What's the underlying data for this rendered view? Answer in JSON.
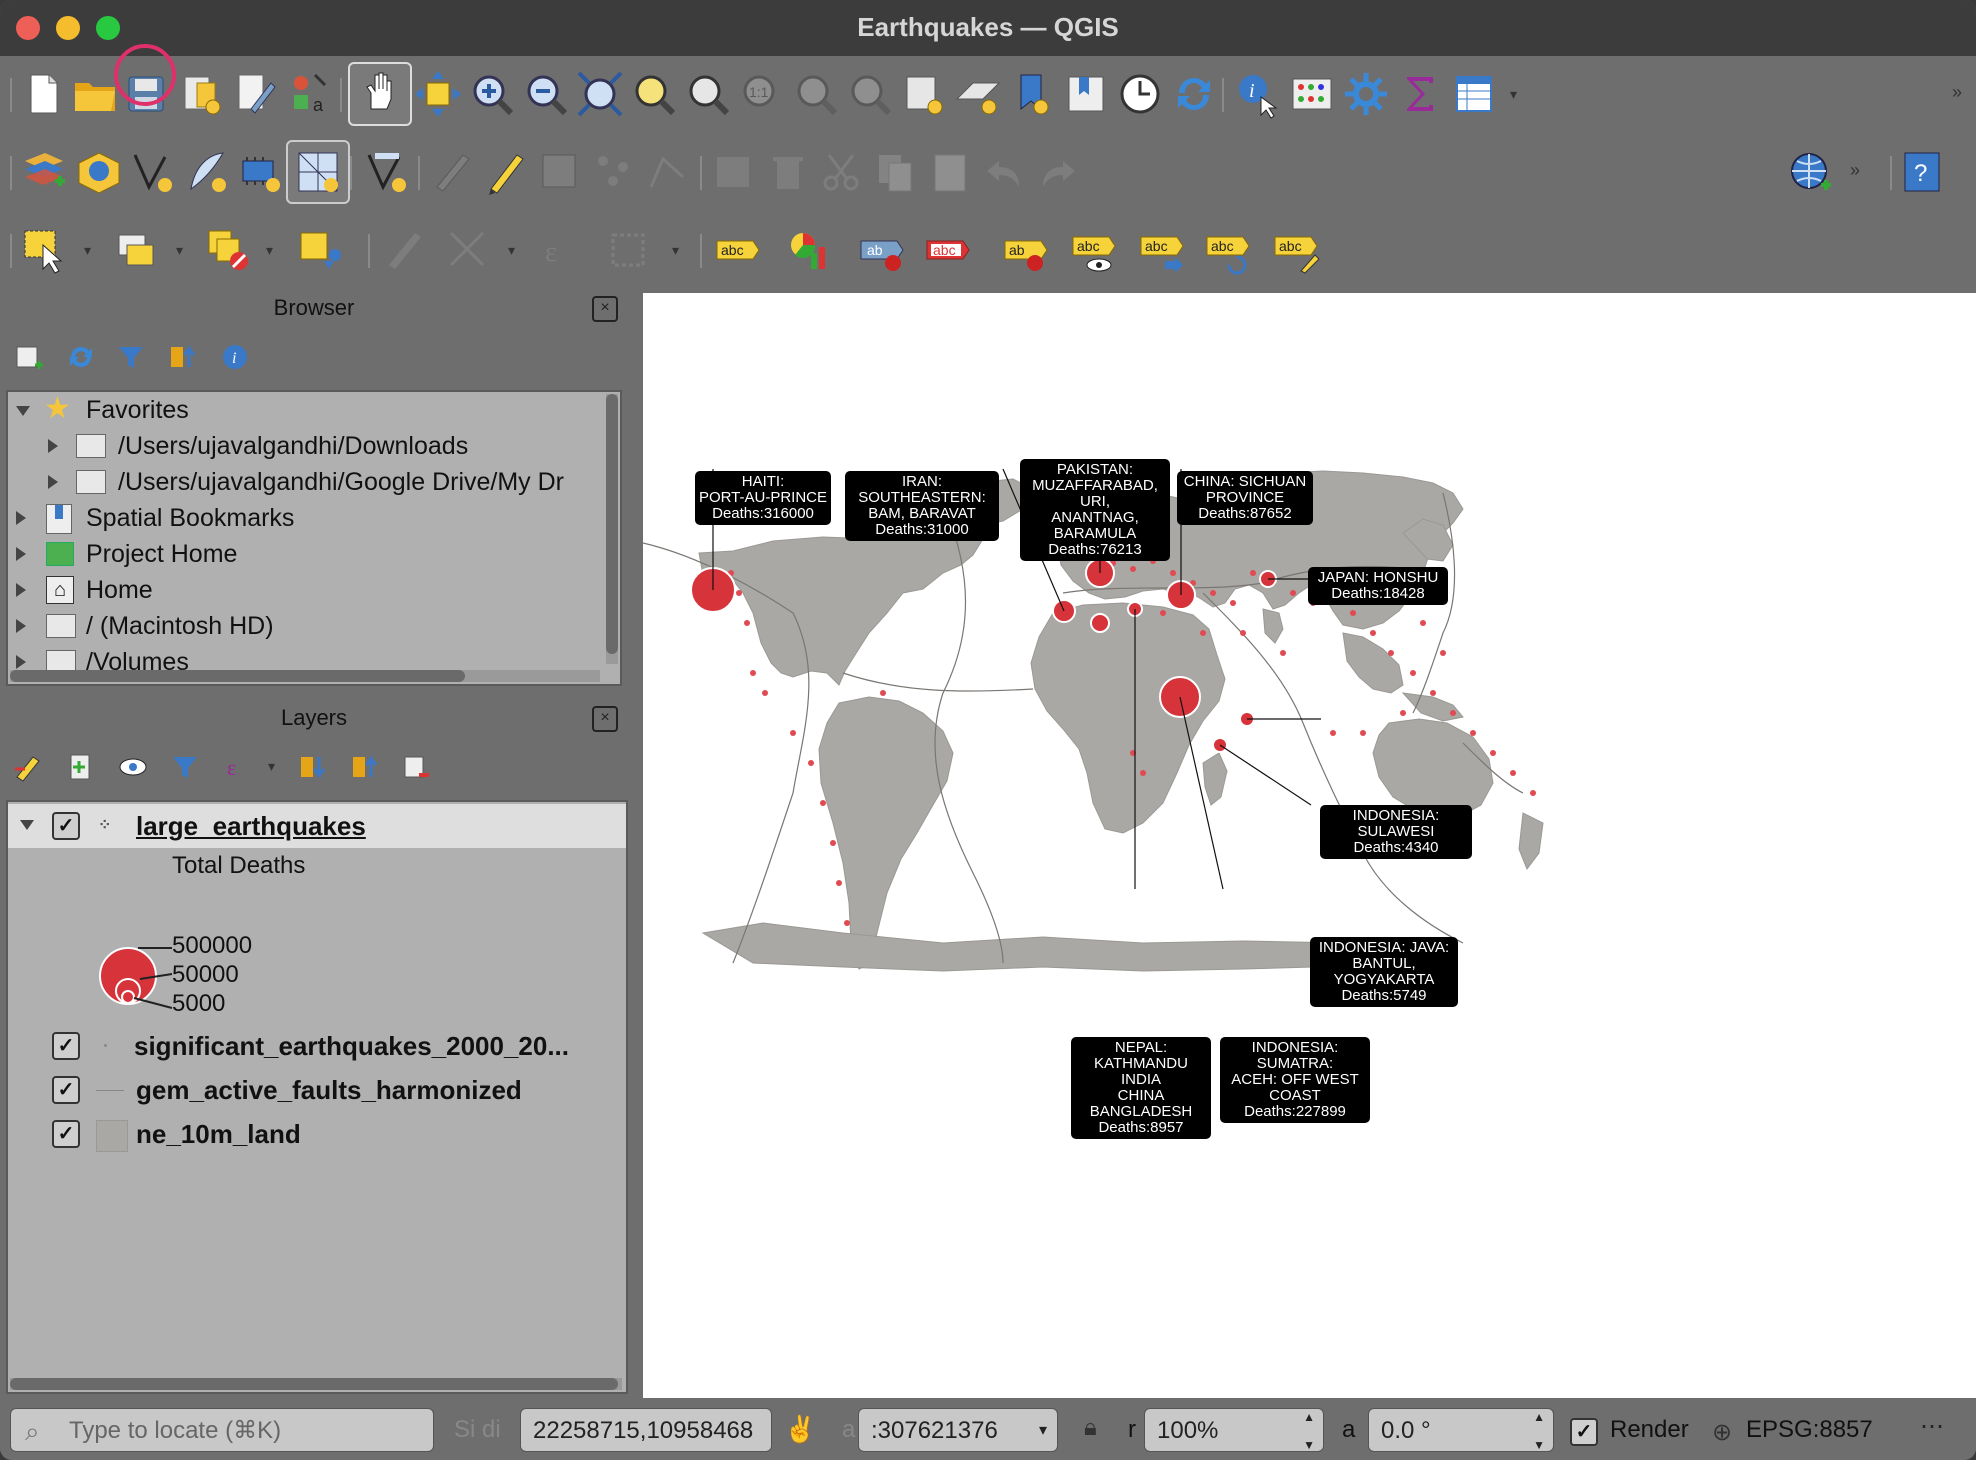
{
  "window": {
    "title": "Earthquakes — QGIS"
  },
  "toolbar": {
    "row1": [
      "new-project",
      "open-project",
      "save-project",
      "new-print-layout",
      "style-manager",
      "layout-manager",
      "pan",
      "pan-to-selection",
      "zoom-in",
      "zoom-out",
      "zoom-full",
      "zoom-to-selection",
      "zoom-to-layer",
      "zoom-native",
      "zoom-last",
      "zoom-next",
      "new-map-view",
      "new-3d-map-view",
      "new-spatial-bookmark",
      "show-bookmarks",
      "temporal-controller",
      "refresh",
      "identify",
      "attribute-table-stats",
      "processing-toolbox",
      "statistical-summary",
      "open-attribute-table"
    ],
    "row3_label_tool_text": "abc"
  },
  "browser": {
    "header": "Browser",
    "items": [
      {
        "label": "Favorites"
      },
      {
        "label": "/Users/ujavalgandhi/Downloads"
      },
      {
        "label": "/Users/ujavalgandhi/Google Drive/My Dr"
      },
      {
        "label": "Spatial Bookmarks"
      },
      {
        "label": "Project Home"
      },
      {
        "label": "Home"
      },
      {
        "label": "/ (Macintosh HD)"
      },
      {
        "label": "/Volumes"
      }
    ]
  },
  "layers": {
    "header": "Layers",
    "items": [
      {
        "label": "large_earthquakes",
        "checked": true
      },
      {
        "label": "significant_earthquakes_2000_20...",
        "checked": true
      },
      {
        "label": "gem_active_faults_harmonized",
        "checked": true
      },
      {
        "label": "ne_10m_land",
        "checked": true
      }
    ],
    "legend": {
      "title": "Total Deaths",
      "values": [
        "500000",
        "50000",
        "5000"
      ]
    }
  },
  "map": {
    "labels": [
      {
        "lines": [
          "HAITI:",
          "PORT-AU-PRINCE",
          "Deaths:316000"
        ]
      },
      {
        "lines": [
          "IRAN:  SOUTHEASTERN:",
          "BAM, BARAVAT",
          "Deaths:31000"
        ]
      },
      {
        "lines": [
          "PAKISTAN:",
          "MUZAFFARABAD, URI,",
          "ANANTNAG, BARAMULA",
          "Deaths:76213"
        ]
      },
      {
        "lines": [
          "CHINA:  SICHUAN",
          "PROVINCE",
          "Deaths:87652"
        ]
      },
      {
        "lines": [
          "JAPAN:  HONSHU",
          "Deaths:18428"
        ]
      },
      {
        "lines": [
          "INDONESIA:  SULAWESI",
          "Deaths:4340"
        ]
      },
      {
        "lines": [
          "INDONESIA:  JAVA:",
          "BANTUL, YOGYAKARTA",
          "Deaths:5749"
        ]
      },
      {
        "lines": [
          "NEPAL:  KATHMANDU",
          "INDIA",
          "CHINA",
          "BANGLADESH",
          "Deaths:8957"
        ]
      },
      {
        "lines": [
          "INDONESIA:  SUMATRA:",
          "ACEH:  OFF WEST",
          "COAST",
          "Deaths:227899"
        ]
      }
    ],
    "colors": {
      "land": "#aaa8a5",
      "quake": "#d6333b",
      "label_bg": "#000000"
    }
  },
  "status": {
    "locate_placeholder": "Type to locate (⌘K)",
    "coord_label": "Si  di",
    "coordinate": "22258715,10958468",
    "scale_label": "a",
    "scale": ":307621376",
    "magnifier_label": "r",
    "magnifier": "100%",
    "rotation_label": "a",
    "rotation": "0.0 °",
    "render_label": "Render",
    "crs": "EPSG:8857"
  }
}
